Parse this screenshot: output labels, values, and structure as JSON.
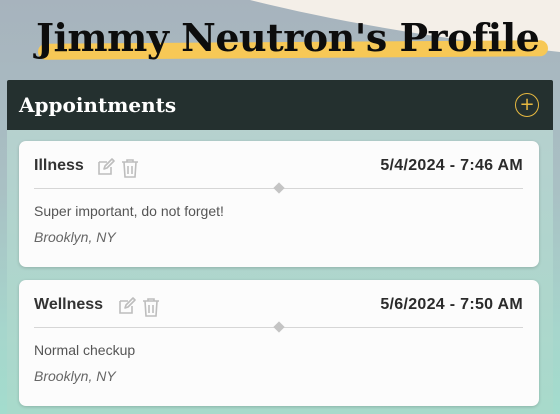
{
  "page": {
    "title": "Jimmy Neutron's Profile"
  },
  "panel": {
    "title": "Appointments",
    "add_icon": "plus-circle-icon"
  },
  "colors": {
    "accent": "#e7b840",
    "header": "#24302f",
    "highlight": "#f7c856"
  },
  "appointments": [
    {
      "type": "Illness",
      "date": "5/4/2024 - 7:46 AM",
      "description": "Super important, do not forget!",
      "location": "Brooklyn, NY"
    },
    {
      "type": "Wellness",
      "date": "5/6/2024 - 7:50 AM",
      "description": "Normal checkup",
      "location": "Brooklyn, NY"
    }
  ]
}
